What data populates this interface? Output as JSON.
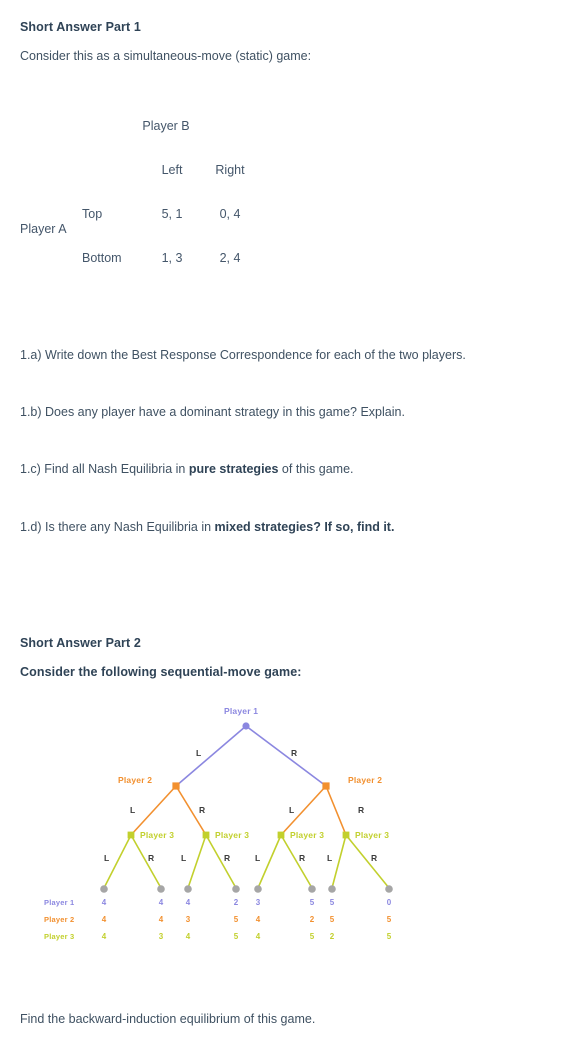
{
  "part1": {
    "heading": "Short Answer Part 1",
    "intro": "Consider this as a simultaneous-move (static) game:",
    "matrix": {
      "col_player_label": "Player B",
      "row_player_label": "Player A",
      "col_headers": [
        "Left",
        "Right"
      ],
      "row_headers": [
        "Top",
        "Bottom"
      ],
      "cells": [
        [
          "5, 1",
          "0, 4"
        ],
        [
          "1, 3",
          "2, 4"
        ]
      ]
    },
    "questions": [
      {
        "id": "1.a",
        "text_plain": "1.a) Write down the Best Response Correspondence for each of the two players.",
        "prefix": "1.a) Write down the Best Response Correspondence for each of the two players.",
        "bold": "",
        "suffix": ""
      },
      {
        "id": "1.b",
        "text_plain": "1.b) Does any player have a dominant strategy in this game? Explain.",
        "prefix": "1.b) Does any player have a dominant strategy in this game? Explain.",
        "bold": "",
        "suffix": ""
      },
      {
        "id": "1.c",
        "text_plain": "1.c) Find all Nash Equilibria in pure strategies of this game.",
        "prefix": "1.c) Find all Nash Equilibria in ",
        "bold": "pure strategies",
        "suffix": " of this game."
      },
      {
        "id": "1.d",
        "text_plain": "1.d) Is there any Nash Equilibria in mixed strategies? If so, find it.",
        "prefix": "1.d) Is there any Nash Equilibria in ",
        "bold": "mixed strategies? If so, find it.",
        "suffix": ""
      }
    ]
  },
  "part2": {
    "heading": "Short Answer Part 2",
    "intro": "Consider the following sequential-move game:",
    "closing": "Find the backward-induction equilibrium of this game.",
    "tree": {
      "colors": {
        "player1": "#8b87e0",
        "player2": "#f2902f",
        "player3": "#c2d02d",
        "terminal": "#a6a6a6",
        "branch_label": "#3c3c3c"
      },
      "node_labels": {
        "root": "Player 1",
        "level2_left": "Player 2",
        "level2_right": "Player 2",
        "level3_a": "Player 3",
        "level3_b": "Player 3",
        "level3_c": "Player 3",
        "level3_d": "Player 3"
      },
      "branch_labels": {
        "root_left": "L",
        "root_right": "R",
        "p2l_left": "L",
        "p2l_right": "R",
        "p2r_left": "L",
        "p2r_right": "R",
        "p3a_left": "L",
        "p3a_right": "R",
        "p3b_left": "L",
        "p3b_right": "R",
        "p3c_left": "L",
        "p3c_right": "R",
        "p3d_left": "L",
        "p3d_right": "R"
      },
      "payoff_row_labels": [
        "Player 1",
        "Player 2",
        "Player 3"
      ],
      "payoffs": [
        {
          "path": "LLL",
          "p1": "4",
          "p2": "4",
          "p3": "4"
        },
        {
          "path": "LLR",
          "p1": "4",
          "p2": "4",
          "p3": "3"
        },
        {
          "path": "LRL",
          "p1": "4",
          "p2": "3",
          "p3": "4"
        },
        {
          "path": "LRR",
          "p1": "2",
          "p2": "5",
          "p3": "5"
        },
        {
          "path": "RLL",
          "p1": "3",
          "p2": "4",
          "p3": "4"
        },
        {
          "path": "RLR",
          "p1": "5",
          "p2": "2",
          "p3": "5"
        },
        {
          "path": "RRL",
          "p1": "5",
          "p2": "5",
          "p3": "2"
        },
        {
          "path": "RRR",
          "p1": "0",
          "p2": "5",
          "p3": "5"
        }
      ]
    }
  }
}
